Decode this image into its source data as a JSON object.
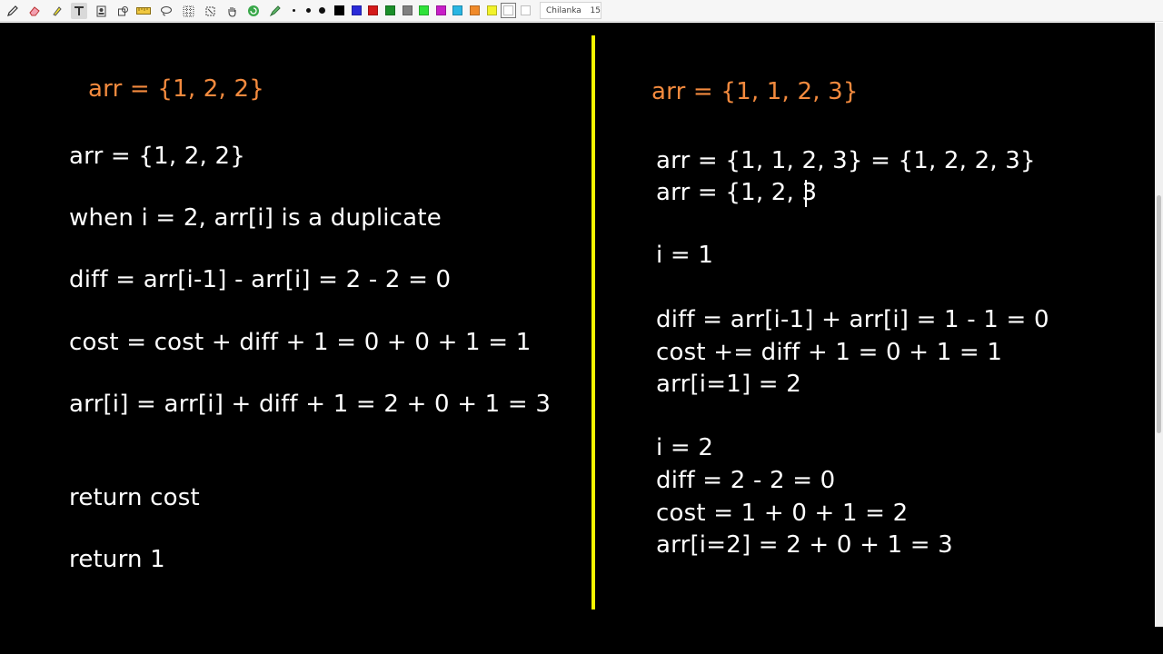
{
  "toolbar": {
    "tools": [
      "pencil-icon",
      "eraser-icon",
      "highlighter-icon",
      "text-icon",
      "stamp-icon",
      "shape-icon",
      "ruler-icon",
      "lasso-icon",
      "grid-icon",
      "select-icon",
      "hand-icon",
      "refresh-icon",
      "pen-settings-icon"
    ],
    "active_tool": "text-icon",
    "colors": [
      "#000000",
      "#2a2ad8",
      "#d41a1a",
      "#1b8f2a",
      "#808080",
      "#2fe23a",
      "#c81ec8",
      "#29b6e3",
      "#f08a2a",
      "#f2f22a",
      "#ffffff",
      "#ffffff"
    ],
    "selected_color_index": 10,
    "font_name": "Chilanka",
    "font_size": "15"
  },
  "colors": {
    "divider": "#f6f600",
    "heading": "#f38a3e",
    "text": "#ffffff",
    "background": "#000000"
  },
  "left": {
    "heading": "arr = {1, 2, 2}",
    "lines": [
      "arr = {1, 2, 2}",
      "when i = 2, arr[i] is a duplicate",
      "diff = arr[i-1] - arr[i] = 2 - 2 = 0",
      "cost = cost + diff + 1 = 0 + 0 + 1 = 1",
      "arr[i] = arr[i] + diff + 1 = 2 + 0 + 1 = 3",
      "return cost",
      "return 1"
    ]
  },
  "right": {
    "heading": "arr = {1, 1, 2, 3}",
    "lines": [
      "arr = {1, 1, 2, 3} = {1, 2, 2, 3}",
      "arr = {1, 2, 3",
      "i = 1",
      "diff = arr[i-1] + arr[i] = 1 - 1 = 0",
      "cost += diff + 1 = 0 + 1 = 1",
      "arr[i=1] = 2",
      "i = 2",
      "diff = 2 - 2 = 0",
      "cost = 1 + 0 + 1 = 2",
      "arr[i=2] = 2 + 0 + 1 = 3"
    ]
  }
}
